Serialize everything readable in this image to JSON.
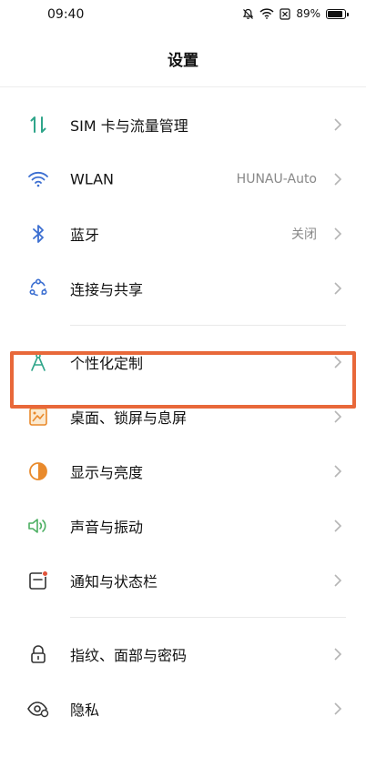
{
  "status": {
    "time": "09:40",
    "battery": "89%"
  },
  "header": {
    "title": "设置"
  },
  "groups": [
    {
      "items": [
        {
          "label": "SIM 卡与流量管理",
          "value": "",
          "icon": "sim-data-icon"
        },
        {
          "label": "WLAN",
          "value": "HUNAU-Auto",
          "icon": "wifi-icon"
        },
        {
          "label": "蓝牙",
          "value": "关闭",
          "icon": "bluetooth-icon"
        },
        {
          "label": "连接与共享",
          "value": "",
          "icon": "connection-share-icon"
        }
      ]
    },
    {
      "items": [
        {
          "label": "个性化定制",
          "value": "",
          "icon": "personalization-icon"
        },
        {
          "label": "桌面、锁屏与息屏",
          "value": "",
          "icon": "wallpaper-icon"
        },
        {
          "label": "显示与亮度",
          "value": "",
          "icon": "brightness-icon"
        },
        {
          "label": "声音与振动",
          "value": "",
          "icon": "sound-icon"
        },
        {
          "label": "通知与状态栏",
          "value": "",
          "icon": "notification-icon"
        }
      ]
    },
    {
      "items": [
        {
          "label": "指纹、面部与密码",
          "value": "",
          "icon": "lock-icon"
        },
        {
          "label": "隐私",
          "value": "",
          "icon": "privacy-eye-icon"
        }
      ]
    }
  ],
  "colors": {
    "highlight": "#e8683a",
    "teal": "#2fa58a",
    "blue": "#3c6fd1",
    "orange": "#e98a2c",
    "green": "#4caf62",
    "red": "#e0533a"
  }
}
